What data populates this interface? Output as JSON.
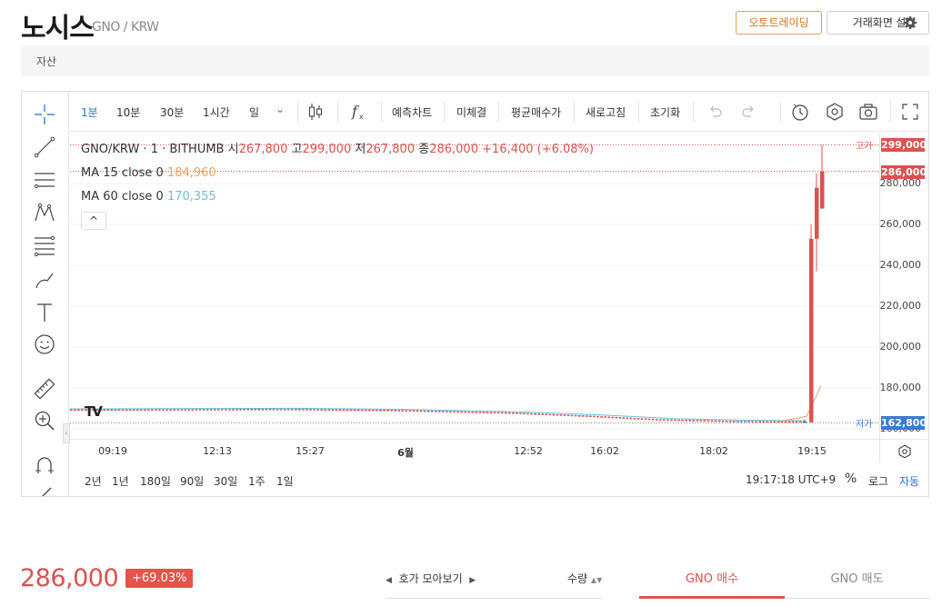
{
  "header": {
    "title": "노시스",
    "pair": "GNO / KRW",
    "auto_trading_label": "오토트레이딩",
    "screen_setting_label": "거래화면 설정"
  },
  "asset_tab": "자산",
  "toolbar": {
    "intervals": [
      "1분",
      "10분",
      "30분",
      "1시간",
      "일"
    ],
    "active_interval": "1분",
    "forecast_label": "예측차트",
    "unfilled_label": "미체결",
    "avg_buy_label": "평균매수가",
    "refresh_label": "새로고침",
    "reset_label": "초기화"
  },
  "legend": {
    "symbol": "GNO/KRW · 1 · BITHUMB",
    "open_label": "시",
    "open": "267,800",
    "high_label": "고",
    "high": "299,000",
    "low_label": "저",
    "low": "267,800",
    "close_label": "종",
    "close": "286,000",
    "change": "+16,400 (+6.08%)",
    "ma15_label": "MA 15 close 0",
    "ma15_value": "184,960",
    "ma60_label": "MA 60 close 0",
    "ma60_value": "170,355",
    "toggle": "^"
  },
  "price_axis": {
    "ticks": [
      "280,000",
      "260,000",
      "240,000",
      "220,000",
      "200,000",
      "180,000",
      "160,000"
    ],
    "high_marker_label": "고가",
    "high_marker": "299,000",
    "last_marker": "286,000",
    "low_marker_label": "저가",
    "low_marker": "162,800"
  },
  "time_axis": {
    "ticks": [
      "09:19",
      "12:13",
      "15:27",
      "6월",
      "12:52",
      "16:02",
      "18:02",
      "19:15"
    ]
  },
  "range_bar": {
    "ranges": [
      "2년",
      "1년",
      "180일",
      "90일",
      "30일",
      "1주",
      "1일"
    ],
    "clock": "19:17:18 UTC+9",
    "percent": "%",
    "log": "로그",
    "auto": "자동"
  },
  "chart_data": {
    "type": "candlestick",
    "ylim": [
      155000,
      305000
    ],
    "candles_tail": [
      {
        "o": 163500,
        "h": 164500,
        "l": 162800,
        "c": 163200
      },
      {
        "o": 163200,
        "h": 260000,
        "l": 162800,
        "c": 253000
      },
      {
        "o": 253000,
        "h": 285000,
        "l": 237000,
        "c": 278000
      },
      {
        "o": 267800,
        "h": 299000,
        "l": 267800,
        "c": 286000
      }
    ],
    "baseline_path": [
      [
        0,
        169000
      ],
      [
        0.3,
        169300
      ],
      [
        0.45,
        168700
      ],
      [
        0.6,
        167500
      ],
      [
        0.7,
        166000
      ],
      [
        0.8,
        164200
      ],
      [
        0.9,
        163400
      ],
      [
        0.97,
        163200
      ]
    ],
    "colors": {
      "up": "#d9534f",
      "down": "#3a7bd5",
      "ma15": "#f0a060",
      "ma60": "#6cc0d8"
    }
  },
  "bottom": {
    "price": "286,000",
    "change_pct": "+69.03%",
    "orderbook_label": "호가 모아보기",
    "qty_label": "수량",
    "buy_tab": "GNO 매수",
    "sell_tab": "GNO 매도"
  }
}
